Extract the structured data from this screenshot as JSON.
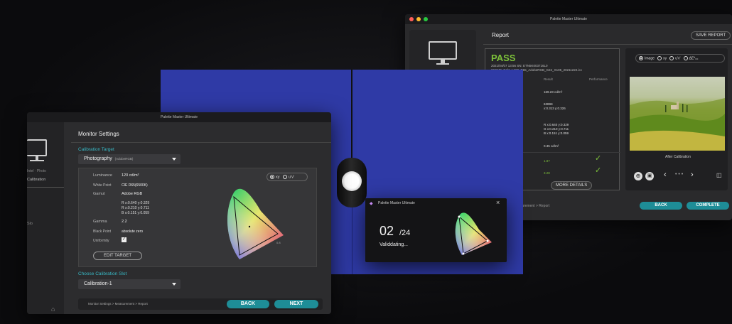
{
  "app_title": "Palette Master Ultimate",
  "report_window": {
    "title": "Palette Master Ultimate",
    "header": "Report",
    "save_button": "SAVE REPORT",
    "result": "PASS",
    "meta_line1": "2021/04/07 13:56   SN: ETN5K003716L0",
    "meta_line2": "SW240_Cal1_L160_D65_AdobeRGB_G22_X105_20211222.icc",
    "col_result": "Result",
    "col_performance": "Performance",
    "luminance": "169.23 cd/m²",
    "white_point_line1": "6389K",
    "white_point_line2": "x:0.313  y:0.326",
    "gamut_r": "R  x:0.640  y:0.329",
    "gamut_g": "G  x:0.210  y:0.711",
    "gamut_b": "B  x:0.151  y:0.059",
    "black": "0.35 cd/m²",
    "delta1": "1.87",
    "delta2": "3.28",
    "more_details": "MORE DETAILS",
    "breadcrumb": "Measurement  >  Report",
    "back": "BACK",
    "complete": "COMPLETE",
    "view_options": [
      "Image",
      "xy",
      "u'v'",
      "ΔE*₀₀"
    ],
    "image_caption": "After Calibration"
  },
  "settings_window": {
    "title": "Palette Master Ultimate",
    "header": "Monitor Settings",
    "side_label1": "Intel · Photo",
    "side_label2": "Calibration",
    "side_label3": "Slo",
    "calibration_target_label": "Calibration Target",
    "target_value": "Photography",
    "target_sub": "(AdobeRGB)",
    "luminance_label": "Luminance",
    "luminance_value": "120 cd/m²",
    "white_point_label": "White Point",
    "white_point_value": "CIE D65(6500K)",
    "gamut_label": "Gamut",
    "gamut_value": "Adobe RGB",
    "gamut_r": "R  x:0.640  y:0.329",
    "gamut_g": "R  x:0.210  y:0.711",
    "gamut_b": "B  x:0.151  y:0.059",
    "gamma_label": "Gamma",
    "gamma_value": "2.2",
    "black_point_label": "Black Point",
    "black_point_value": "absolute zero",
    "uniformity_label": "Uniformity",
    "edit_target": "EDIT TARGET",
    "chart_options": [
      "xy",
      "u'v'"
    ],
    "slot_label": "Choose Calibration Slot",
    "slot_value": "Calibration-1",
    "breadcrumb": "Monitor Settings  >  Measurement  >  Report",
    "back": "BACK",
    "next": "NEXT"
  },
  "progress_dialog": {
    "title": "Palette Master Ultimate",
    "count": "02",
    "total": "/24",
    "status": "Validdating..."
  },
  "colors": {
    "accent": "#1e8d97",
    "pass": "#7dc13a",
    "screen_blue": "#2f3aa6"
  }
}
